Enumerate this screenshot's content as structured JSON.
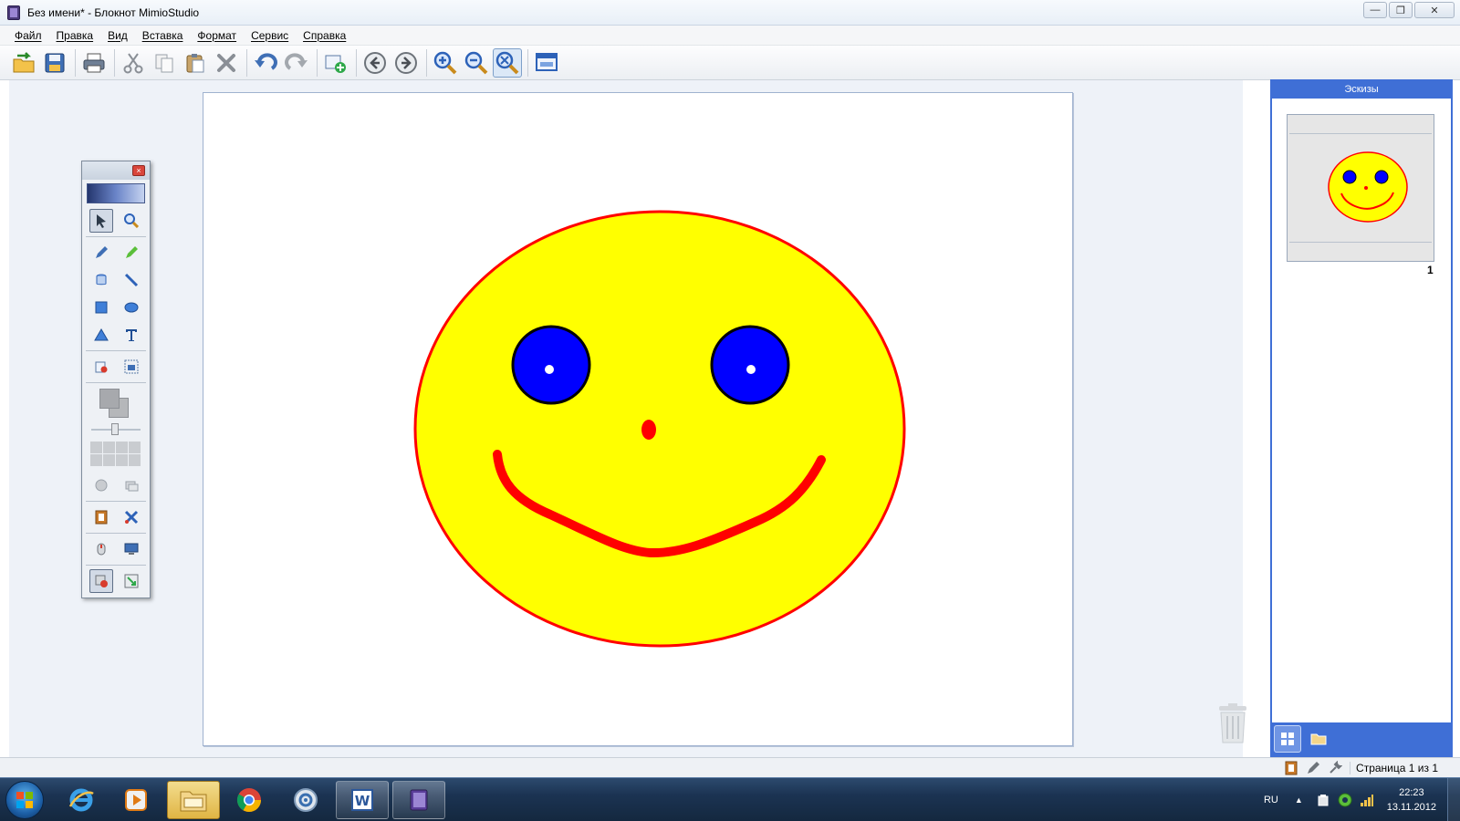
{
  "window": {
    "title": "Без имени* - Блокнот MimioStudio",
    "minimize_glyph": "—",
    "maximize_glyph": "❐",
    "close_glyph": "✕"
  },
  "menu": {
    "items": [
      "Файл",
      "Правка",
      "Вид",
      "Вставка",
      "Формат",
      "Сервис",
      "Справка"
    ]
  },
  "toolbar": {
    "icons": [
      "open-icon",
      "save-icon",
      "print-icon",
      "cut-icon",
      "copy-icon",
      "paste-icon",
      "delete-icon",
      "undo-icon",
      "redo-icon",
      "add-page-icon",
      "back-icon",
      "forward-icon",
      "zoom-in-icon",
      "zoom-out-icon",
      "zoom-fit-icon",
      "screen-icon"
    ]
  },
  "palette": {
    "close_glyph": "×"
  },
  "canvas": {
    "face_fill": "#ffff00",
    "face_stroke": "#ff0000",
    "eye_fill": "#0000ff",
    "mouth_color": "#ff0000"
  },
  "thumbnails": {
    "title": "Эскизы",
    "page_number": "1"
  },
  "status": {
    "page_text": "Страница 1 из 1"
  },
  "taskbar": {
    "language": "RU",
    "time": "22:23",
    "date": "13.11.2012",
    "apps": [
      "internet-explorer-icon",
      "media-player-icon",
      "explorer-icon",
      "chrome-icon",
      "disc-icon",
      "word-icon",
      "mimio-notebook-icon"
    ]
  }
}
